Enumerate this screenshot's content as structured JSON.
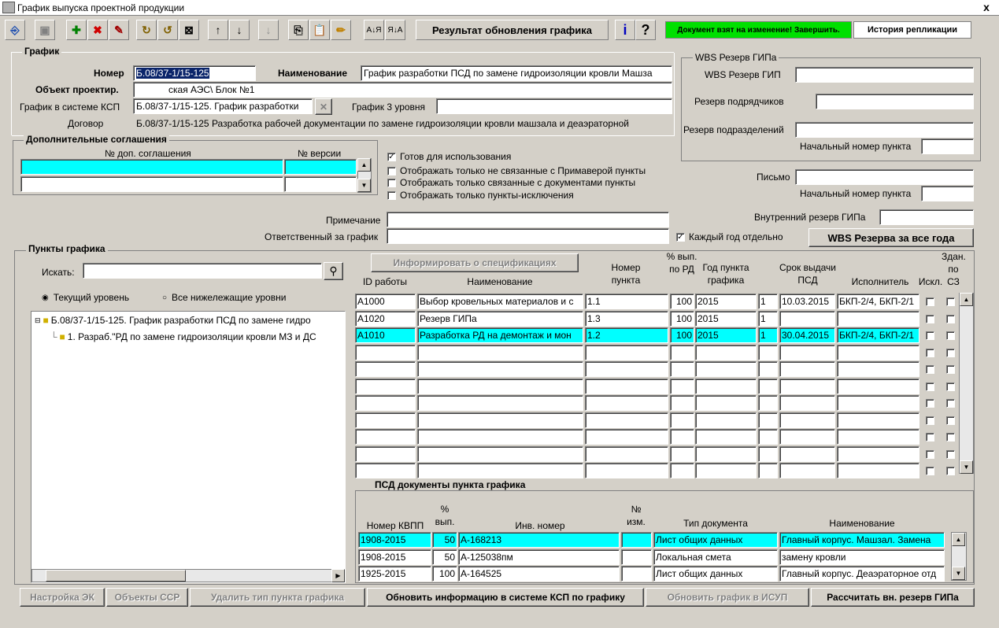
{
  "window": {
    "title": "График выпуска проектной продукции",
    "close": "x"
  },
  "toolbar": {
    "update_result": "Результат обновления графика",
    "info": "i",
    "help": "?",
    "doc_status": "Документ взят на изменение! Завершить.",
    "history": "История репликации",
    "sort_az": "А↓Я",
    "sort_za": "Я↓А"
  },
  "schedule": {
    "group": "График",
    "number_label": "Номер",
    "number_value": "Б.08/37-1/15-125",
    "name_label": "Наименование",
    "name_value": "График разработки ПСД  по замене гидроизоляции кровли Машза",
    "object_label": "Объект проектир.",
    "object_value": "ская АЭС\\ Блок №1",
    "ksp_label": "График в системе КСП",
    "ksp_value": "Б.08/37-1/15-125. График разработки",
    "level3_label": "График 3 уровня",
    "level3_value": "",
    "contract_label": "Договор",
    "contract_value": "Б.08/37-1/15-125   Разработка рабочей документации по замене гидроизоляции кровли машзала и деаэраторной"
  },
  "agreements": {
    "group": "Дополнительные соглашения",
    "col1": "№ доп. соглашения",
    "col2": "№ версии"
  },
  "options": {
    "ready": "Готов для использования",
    "only_not_linked": "Отображать только не связанные с Примаверой пункты",
    "only_linked_docs": "Отображать только связанные с документами пункты",
    "only_exceptions": "Отображать только пункты-исключения"
  },
  "wbs": {
    "group": "WBS Резерв ГИПа",
    "wbs_gip": "WBS Резерв ГИП",
    "contractors": "Резерв подрядчиков",
    "divisions": "Резерв подразделений",
    "start_num": "Начальный номер пункта",
    "letter": "Письмо",
    "start_num2": "Начальный номер пункта",
    "internal": "Внутренний резерв ГИПа",
    "each_year": "Каждый год отдельно",
    "wbs_all_years": "WBS Резерва за все года"
  },
  "notes": {
    "note_label": "Примечание",
    "responsible_label": "Ответственный за график"
  },
  "points": {
    "group": "Пункты графика",
    "search_label": "Искать:",
    "radio_current": "Текущий уровень",
    "radio_all": "Все нижележащие уровни",
    "tree_root": "Б.08/37-1/15-125. График разработки ПСД  по замене гидро",
    "tree_child": "1. Разраб.\"РД по замене гидроизоляции кровли МЗ и ДС",
    "inform_btn": "Информировать о спецификациях"
  },
  "grid": {
    "headers": {
      "id": "ID работы",
      "name": "Наименование",
      "num": "Номер пункта",
      "pct": "% вып. по РД",
      "year": "Год пункта графика",
      "term": "Срок выдачи ПСД",
      "exec": "Исполнитель",
      "excl": "Искл.",
      "sz": "Здан. по СЗ"
    },
    "rows": [
      {
        "id": "А1000",
        "name": "Выбор кровельных материалов и с",
        "num": "1.1",
        "pct": "100",
        "year": "2015",
        "v": "1",
        "term": "10.03.2015",
        "exec": "БКП-2/4, БКП-2/1"
      },
      {
        "id": "А1020",
        "name": "Резерв ГИПа",
        "num": "1.3",
        "pct": "100",
        "year": "2015",
        "v": "1",
        "term": "",
        "exec": ""
      },
      {
        "id": "А1010",
        "name": "Разработка РД на демонтаж и мон",
        "num": "1.2",
        "pct": "100",
        "year": "2015",
        "v": "1",
        "term": "30.04.2015",
        "exec": "БКП-2/4, БКП-2/1"
      }
    ]
  },
  "docs": {
    "group": "ПСД документы пункта графика",
    "h_kvpp": "Номер КВПП",
    "h_pct": "% вып.",
    "h_inv": "Инв. номер",
    "h_izm": "№ изм.",
    "h_type": "Тип документа",
    "h_name": "Наименование",
    "rows": [
      {
        "kvpp": "1908-2015",
        "pct": "50",
        "inv": "А-168213",
        "izm": "",
        "type": "Лист общих данных",
        "name": "Главный корпус. Машзал. Замена"
      },
      {
        "kvpp": "1908-2015",
        "pct": "50",
        "inv": "А-125038пм",
        "izm": "",
        "type": "Локальная смета",
        "name": "замену кровли"
      },
      {
        "kvpp": "1925-2015",
        "pct": "100",
        "inv": "А-164525",
        "izm": "",
        "type": "Лист общих данных",
        "name": "Главный корпус. Деаэраторное отд"
      }
    ]
  },
  "bottom": {
    "ek": "Настройка ЭК",
    "ssr": "Объекты ССР",
    "del_type": "Удалить тип пункта графика",
    "update_ksp": "Обновить информацию в системе КСП по графику",
    "update_isup": "Обновить график в ИСУП",
    "calc": "Рассчитать вн. резерв ГИПа"
  },
  "colors": {
    "face": "#d4d0c8",
    "selected": "#00ffff",
    "status_green": "#00e000"
  }
}
